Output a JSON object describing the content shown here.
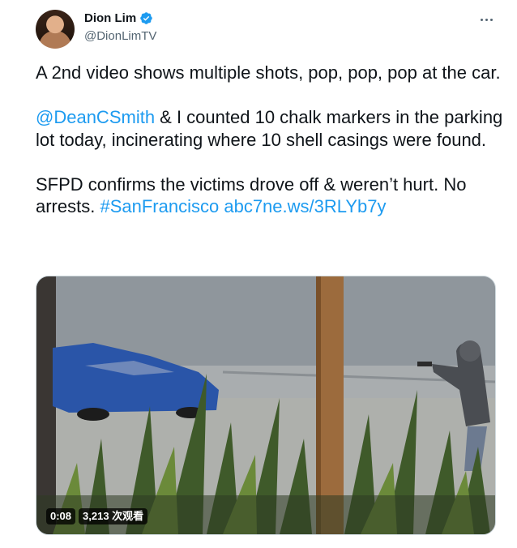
{
  "author": {
    "display_name": "Dion Lim",
    "handle": "@DionLimTV",
    "verified": true
  },
  "tweet": {
    "p1": "A 2nd video shows multiple shots, pop, pop, pop at the car.",
    "mention": "@DeanCSmith",
    "p2_rest": " & I counted 10 chalk markers in the parking lot today, incinerating where 10 shell casings were found.",
    "p3_text": "SFPD confirms the victims drove off & weren’t hurt. No arrests. ",
    "hashtag": "#SanFrancisco",
    "link": "abc7ne.ws/3RLYb7y"
  },
  "media": {
    "duration": "0:08",
    "views": "3,213 次观看"
  },
  "colors": {
    "link": "#1d9bf0",
    "text": "#0f1419",
    "muted": "#536471",
    "verified": "#1d9bf0"
  }
}
